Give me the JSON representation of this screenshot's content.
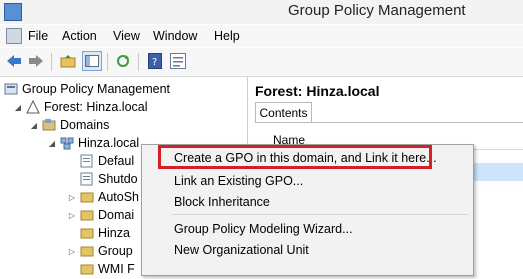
{
  "window": {
    "title": "Group Policy Management"
  },
  "menu": [
    "File",
    "Action",
    "View",
    "Window",
    "Help"
  ],
  "toolbar_icons": [
    "back-arrow-icon",
    "forward-arrow-icon",
    "folder-up-icon",
    "show-hide-tree-icon",
    "refresh-icon",
    "help-icon",
    "properties-icon"
  ],
  "tree": {
    "root": "Group Policy Management",
    "forest": "Forest: Hinza.local",
    "domains": "Domains",
    "domain": "Hinza.local",
    "children": [
      "Defaul",
      "Shutdo",
      "AutoSh",
      "Domai",
      "Hinza",
      "Group",
      "WMI F"
    ]
  },
  "right": {
    "title": "Forest: Hinza.local",
    "tab": "Contents",
    "column": "Name"
  },
  "context_menu": {
    "items": [
      "Create a GPO in this domain, and Link it here...",
      "Link an Existing GPO...",
      "Block Inheritance",
      "Group Policy Modeling Wizard...",
      "New Organizational Unit"
    ]
  },
  "colors": {
    "highlight": "#d3202b",
    "selection": "#cde4fb"
  }
}
